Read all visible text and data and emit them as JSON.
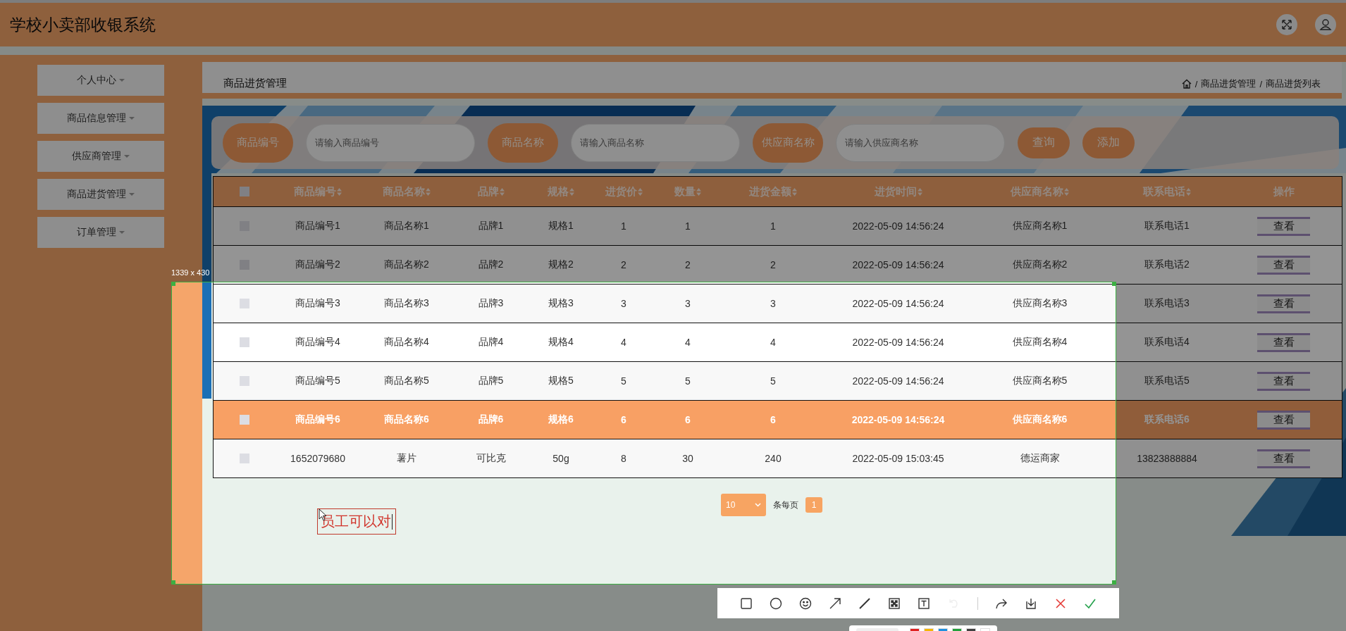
{
  "app": {
    "title": "学校小卖部收银系统"
  },
  "sidebar": {
    "items": [
      {
        "label": "个人中心"
      },
      {
        "label": "商品信息管理"
      },
      {
        "label": "供应商管理"
      },
      {
        "label": "商品进货管理"
      },
      {
        "label": "订单管理"
      }
    ]
  },
  "page": {
    "title": "商品进货管理",
    "breadcrumb": {
      "separator": "/",
      "items": [
        "商品进货管理",
        "商品进货列表"
      ]
    }
  },
  "search": {
    "fields": [
      {
        "label": "商品编号",
        "placeholder": "请输入商品编号"
      },
      {
        "label": "商品名称",
        "placeholder": "请输入商品名称"
      },
      {
        "label": "供应商名称",
        "placeholder": "请输入供应商名称"
      }
    ],
    "buttons": [
      "查询",
      "添加"
    ]
  },
  "table": {
    "header_checked": false,
    "columns": [
      {
        "label": "商品编号",
        "sortable": true
      },
      {
        "label": "商品名称",
        "sortable": true
      },
      {
        "label": "品牌",
        "sortable": true
      },
      {
        "label": "规格",
        "sortable": true
      },
      {
        "label": "进货价",
        "sortable": true
      },
      {
        "label": "数量",
        "sortable": true
      },
      {
        "label": "进货金额",
        "sortable": true
      },
      {
        "label": "进货时间",
        "sortable": true
      },
      {
        "label": "供应商名称",
        "sortable": true
      },
      {
        "label": "联系电话",
        "sortable": true
      },
      {
        "label": "操作",
        "sortable": false
      }
    ],
    "rows": [
      {
        "checked": false,
        "selected": false,
        "cells": [
          "商品编号1",
          "商品名称1",
          "品牌1",
          "规格1",
          "1",
          "1",
          "1",
          "2022-05-09 14:56:24",
          "供应商名称1",
          "联系电话1"
        ],
        "action": "查看"
      },
      {
        "checked": false,
        "selected": false,
        "cells": [
          "商品编号2",
          "商品名称2",
          "品牌2",
          "规格2",
          "2",
          "2",
          "2",
          "2022-05-09 14:56:24",
          "供应商名称2",
          "联系电话2"
        ],
        "action": "查看"
      },
      {
        "checked": false,
        "selected": false,
        "cells": [
          "商品编号3",
          "商品名称3",
          "品牌3",
          "规格3",
          "3",
          "3",
          "3",
          "2022-05-09 14:56:24",
          "供应商名称3",
          "联系电话3"
        ],
        "action": "查看"
      },
      {
        "checked": false,
        "selected": false,
        "cells": [
          "商品编号4",
          "商品名称4",
          "品牌4",
          "规格4",
          "4",
          "4",
          "4",
          "2022-05-09 14:56:24",
          "供应商名称4",
          "联系电话4"
        ],
        "action": "查看"
      },
      {
        "checked": false,
        "selected": false,
        "cells": [
          "商品编号5",
          "商品名称5",
          "品牌5",
          "规格5",
          "5",
          "5",
          "5",
          "2022-05-09 14:56:24",
          "供应商名称5",
          "联系电话5"
        ],
        "action": "查看"
      },
      {
        "checked": false,
        "selected": true,
        "cells": [
          "商品编号6",
          "商品名称6",
          "品牌6",
          "规格6",
          "6",
          "6",
          "6",
          "2022-05-09 14:56:24",
          "供应商名称6",
          "联系电话6"
        ],
        "action": "查看"
      },
      {
        "checked": false,
        "selected": false,
        "cells": [
          "1652079680",
          "薯片",
          "可比克",
          "50g",
          "8",
          "30",
          "240",
          "2022-05-09 15:03:45",
          "德运商家",
          "13823888884"
        ],
        "action": "查看"
      }
    ]
  },
  "pagination": {
    "page_size": "10",
    "page_size_label": "条每页",
    "pages": [
      {
        "label": "1",
        "selected": true
      }
    ]
  },
  "capture": {
    "size_label": "1339 x 430",
    "annotation": "员工可以对",
    "tools": [
      {
        "kind": "rectangle",
        "disabled": false
      },
      {
        "kind": "ellipse",
        "disabled": false
      },
      {
        "kind": "emoji",
        "disabled": false
      },
      {
        "kind": "arrow",
        "disabled": false
      },
      {
        "kind": "pen",
        "disabled": false
      },
      {
        "kind": "mosaic",
        "disabled": false
      },
      {
        "kind": "text",
        "disabled": false
      },
      {
        "kind": "undo",
        "disabled": true
      }
    ],
    "actions": [
      {
        "kind": "share",
        "disabled": false
      },
      {
        "kind": "save",
        "disabled": false
      },
      {
        "kind": "cancel",
        "disabled": false
      },
      {
        "kind": "confirm",
        "disabled": false
      }
    ],
    "palette": [
      {
        "color": "#e02020"
      },
      {
        "color": "#f5b400"
      },
      {
        "color": "#1e90e0"
      },
      {
        "color": "#22a03a"
      },
      {
        "color": "#404040"
      },
      {
        "color": "#ffffff"
      }
    ]
  }
}
